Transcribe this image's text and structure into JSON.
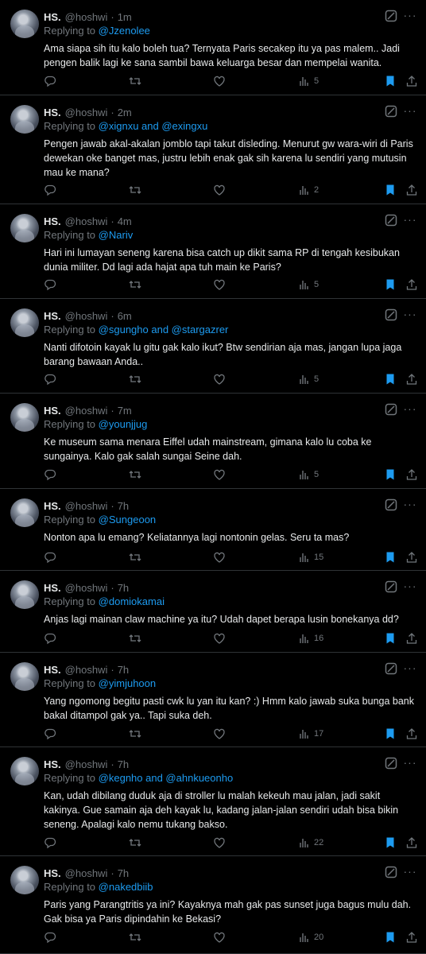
{
  "colors": {
    "background": "#000000",
    "text": "#e7e9ea",
    "muted": "#71767b",
    "accent": "#1d9bf0",
    "divider": "#2f3336"
  },
  "icons": {
    "reply": "reply-icon",
    "retweet": "retweet-icon",
    "like": "heart-icon",
    "views": "views-icon",
    "bookmark": "bookmark-filled-icon",
    "share": "share-icon",
    "grok": "grok-icon",
    "more": "more-icon"
  },
  "tweets": [
    {
      "name": "HS.",
      "handle": "@hoshwi",
      "dot": "·",
      "time": "1m",
      "replying_label": "Replying to",
      "replying_to": "@Jzenolee",
      "text": "Ama siapa sih itu kalo boleh tua? Ternyata Paris secakep itu ya pas malem.. Jadi pengen balik lagi ke sana sambil bawa keluarga besar dan mempelai wanita.",
      "views": "5"
    },
    {
      "name": "HS.",
      "handle": "@hoshwi",
      "dot": "·",
      "time": "2m",
      "replying_label": "Replying to",
      "replying_to": "@xignxu and @exingxu",
      "text": "Pengen jawab akal-akalan jomblo tapi takut disleding. Menurut gw wara-wiri di Paris dewekan oke banget mas, justru lebih enak gak sih karena lu sendiri yang mutusin mau ke mana?",
      "views": "2"
    },
    {
      "name": "HS.",
      "handle": "@hoshwi",
      "dot": "·",
      "time": "4m",
      "replying_label": "Replying to",
      "replying_to": "@Nariv",
      "text": "Hari ini lumayan seneng karena bisa catch up dikit sama RP di tengah kesibukan dunia militer. Dd lagi ada hajat apa tuh main ke Paris?",
      "views": "5"
    },
    {
      "name": "HS.",
      "handle": "@hoshwi",
      "dot": "·",
      "time": "6m",
      "replying_label": "Replying to",
      "replying_to": "@sgungho and @stargazrer",
      "text": "Nanti difotoin kayak lu gitu gak kalo ikut? Btw sendirian aja mas, jangan lupa jaga barang bawaan Anda..",
      "views": "5"
    },
    {
      "name": "HS.",
      "handle": "@hoshwi",
      "dot": "·",
      "time": "7m",
      "replying_label": "Replying to",
      "replying_to": "@younjjug",
      "text": "Ke museum sama menara Eiffel udah mainstream, gimana kalo lu coba ke sungainya. Kalo gak salah sungai Seine dah.",
      "views": "5"
    },
    {
      "name": "HS.",
      "handle": "@hoshwi",
      "dot": "·",
      "time": "7h",
      "replying_label": "Replying to",
      "replying_to": "@Sungeoon",
      "text": "Nonton apa lu emang? Keliatannya lagi nontonin gelas. Seru ta mas?",
      "views": "15"
    },
    {
      "name": "HS.",
      "handle": "@hoshwi",
      "dot": "·",
      "time": "7h",
      "replying_label": "Replying to",
      "replying_to": "@domiokamai",
      "text": "Anjas lagi mainan claw machine ya itu? Udah dapet berapa lusin bonekanya dd?",
      "views": "16"
    },
    {
      "name": "HS.",
      "handle": "@hoshwi",
      "dot": "·",
      "time": "7h",
      "replying_label": "Replying to",
      "replying_to": "@yimjuhoon",
      "text": "Yang ngomong begitu pasti cwk lu yan itu kan? :) Hmm kalo jawab suka bunga bank bakal ditampol gak ya.. Tapi suka deh.",
      "views": "17"
    },
    {
      "name": "HS.",
      "handle": "@hoshwi",
      "dot": "·",
      "time": "7h",
      "replying_label": "Replying to",
      "replying_to": "@kegnho and @ahnkueonho",
      "text": "Kan, udah dibilang duduk aja di stroller lu malah kekeuh mau jalan, jadi sakit kakinya. Gue samain aja deh kayak lu, kadang jalan-jalan sendiri udah bisa bikin seneng. Apalagi kalo nemu tukang bakso.",
      "views": "22"
    },
    {
      "name": "HS.",
      "handle": "@hoshwi",
      "dot": "·",
      "time": "7h",
      "replying_label": "Replying to",
      "replying_to": "@nakedbiib",
      "text": "Paris yang Parangtritis ya  ini? Kayaknya mah gak pas sunset juga bagus mulu dah. Gak bisa ya Paris dipindahin ke Bekasi?",
      "views": "20"
    }
  ]
}
